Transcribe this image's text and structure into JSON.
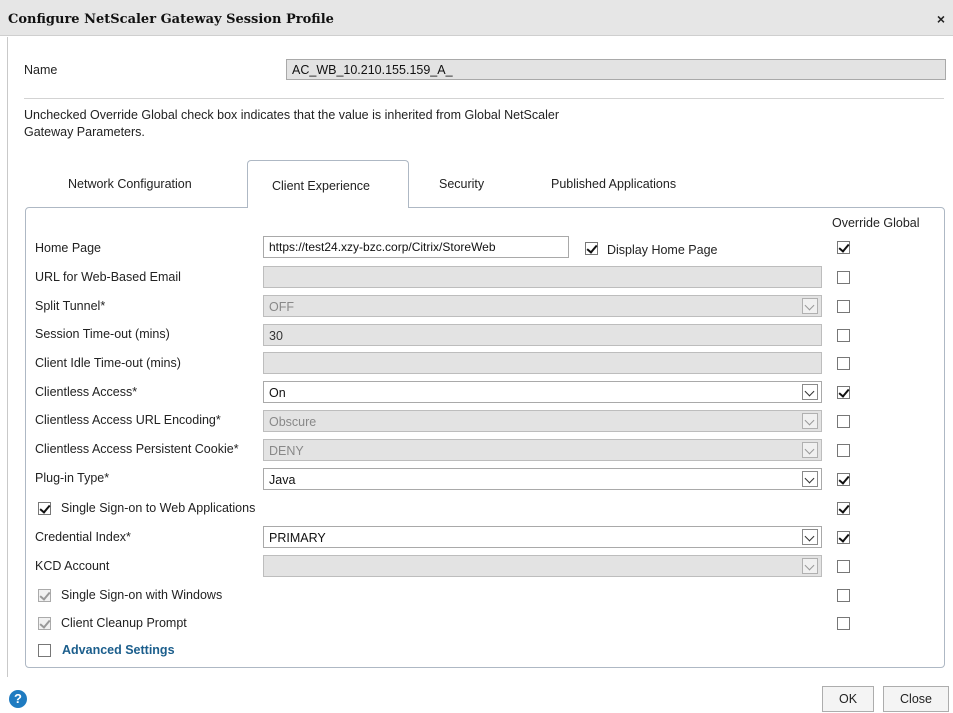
{
  "window": {
    "title": "Configure NetScaler Gateway Session Profile",
    "close_glyph": "×"
  },
  "name_field": {
    "label": "Name",
    "value": "AC_WB_10.210.155.159_A_"
  },
  "info_text": "Unchecked Override Global check box indicates that the value is inherited from Global NetScaler Gateway Parameters.",
  "tabs": [
    {
      "label": "Network Configuration",
      "active": false
    },
    {
      "label": "Client Experience",
      "active": true
    },
    {
      "label": "Security",
      "active": false
    },
    {
      "label": "Published Applications",
      "active": false
    }
  ],
  "override_header": "Override Global",
  "fields": {
    "home_page": {
      "label": "Home Page",
      "value": "https://test24.xzy-bzc.corp/Citrix/StoreWeb",
      "display_label": "Display Home Page",
      "display_checked": true,
      "override": true
    },
    "web_email": {
      "label": "URL for Web-Based Email",
      "value": "",
      "override": false
    },
    "split_tunnel": {
      "label": "Split Tunnel*",
      "value": "OFF",
      "override": false
    },
    "session_timeout": {
      "label": "Session Time-out (mins)",
      "value": "30",
      "override": false
    },
    "idle_timeout": {
      "label": "Client Idle Time-out (mins)",
      "value": "",
      "override": false
    },
    "clientless_access": {
      "label": "Clientless Access*",
      "value": "On",
      "override": true
    },
    "url_encoding": {
      "label": "Clientless Access URL Encoding*",
      "value": "Obscure",
      "override": false
    },
    "persistent_cookie": {
      "label": "Clientless Access Persistent Cookie*",
      "value": "DENY",
      "override": false
    },
    "plugin_type": {
      "label": "Plug-in Type*",
      "value": "Java",
      "override": true
    },
    "sso_web": {
      "label": "Single Sign-on to Web Applications",
      "checked": true,
      "override": true
    },
    "credential_index": {
      "label": "Credential Index*",
      "value": "PRIMARY",
      "override": true
    },
    "kcd_account": {
      "label": "KCD Account",
      "value": "",
      "override": false
    },
    "sso_windows": {
      "label": "Single Sign-on with Windows",
      "checked": true,
      "override": false
    },
    "cleanup_prompt": {
      "label": "Client Cleanup Prompt",
      "checked": true,
      "override": false
    },
    "advanced": {
      "label": "Advanced Settings",
      "checked": false
    }
  },
  "buttons": {
    "ok": "OK",
    "close": "Close",
    "help": "?"
  },
  "colors": {
    "accent": "#1f7bc1",
    "link": "#1b5e8c"
  }
}
